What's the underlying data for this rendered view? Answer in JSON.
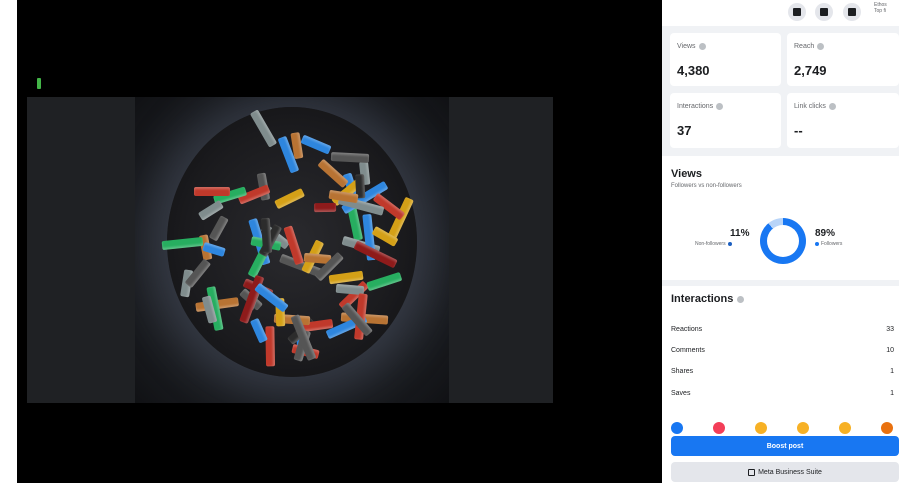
{
  "top_bar": {
    "icons": [
      "grid-menu-icon",
      "messenger-icon",
      "notifications-icon"
    ],
    "profile_name": "Ethos",
    "profile_sub": "Top fi"
  },
  "stats": {
    "views_label": "Views",
    "views_value": "4,380",
    "reach_label": "Reach",
    "reach_value": "2,749",
    "interactions_label": "Interactions",
    "interactions_value": "37",
    "link_clicks_label": "Link clicks",
    "link_clicks_value": "--"
  },
  "views_section": {
    "title": "Views",
    "subtitle": "Followers vs non-followers",
    "non_followers_pct": "11%",
    "non_followers_label": "Non-followers",
    "followers_pct": "89%",
    "followers_label": "Followers",
    "followers_share": 0.89,
    "colors": {
      "followers": "#1877f2",
      "non_followers": "#b8d4f8"
    }
  },
  "interactions_section": {
    "title": "Interactions",
    "rows": [
      {
        "label": "Reactions",
        "value": "33"
      },
      {
        "label": "Comments",
        "value": "10"
      },
      {
        "label": "Shares",
        "value": "1"
      },
      {
        "label": "Saves",
        "value": "1"
      }
    ],
    "reaction_icons": [
      "like-icon",
      "love-icon",
      "care-icon",
      "haha-icon",
      "wow-icon",
      "angry-icon"
    ]
  },
  "buttons": {
    "boost_label": "Boost post",
    "meta_business_label": "Meta Business Suite"
  },
  "accent_color": "#1877f2"
}
